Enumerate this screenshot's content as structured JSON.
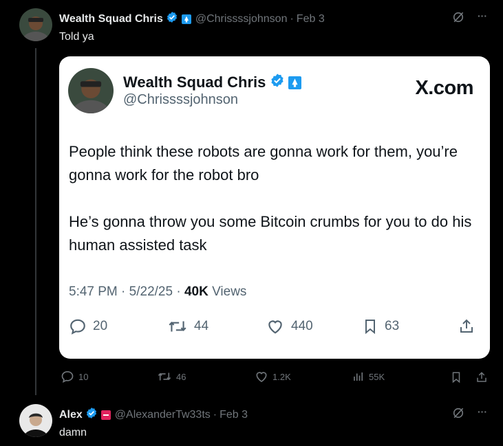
{
  "main_post": {
    "author_name": "Wealth Squad Chris",
    "handle": "@Chrissssjohnson",
    "separator": "·",
    "date": "Feb 3",
    "text": "Told ya",
    "more_label": "···"
  },
  "embedded_card": {
    "author_name": "Wealth Squad Chris",
    "handle": "@Chrissssjohnson",
    "site_label": "X.com",
    "paragraphs": [
      "People think these robots are gonna work for them, you’re gonna work for the robot bro",
      "He’s gonna throw you some Bitcoin crumbs for you to do his human assisted task"
    ],
    "time": "5:47 PM",
    "date": "5/22/25",
    "views_count": "40K",
    "views_label": "Views",
    "separator": "·",
    "replies": "20",
    "reposts": "44",
    "likes": "440",
    "bookmarks": "63"
  },
  "action_bar": {
    "replies": "10",
    "reposts": "46",
    "likes": "1.2K",
    "views": "55K"
  },
  "reply_post": {
    "author_name": "Alex",
    "handle": "@AlexanderTw33ts",
    "separator": "·",
    "date": "Feb 3",
    "text": "damn",
    "more_label": "···"
  },
  "colors": {
    "verified": "#1d9bf0",
    "affiliate_blue": "#1d9bf0",
    "affiliate_red": "#e0245e",
    "muted": "#71767b"
  }
}
